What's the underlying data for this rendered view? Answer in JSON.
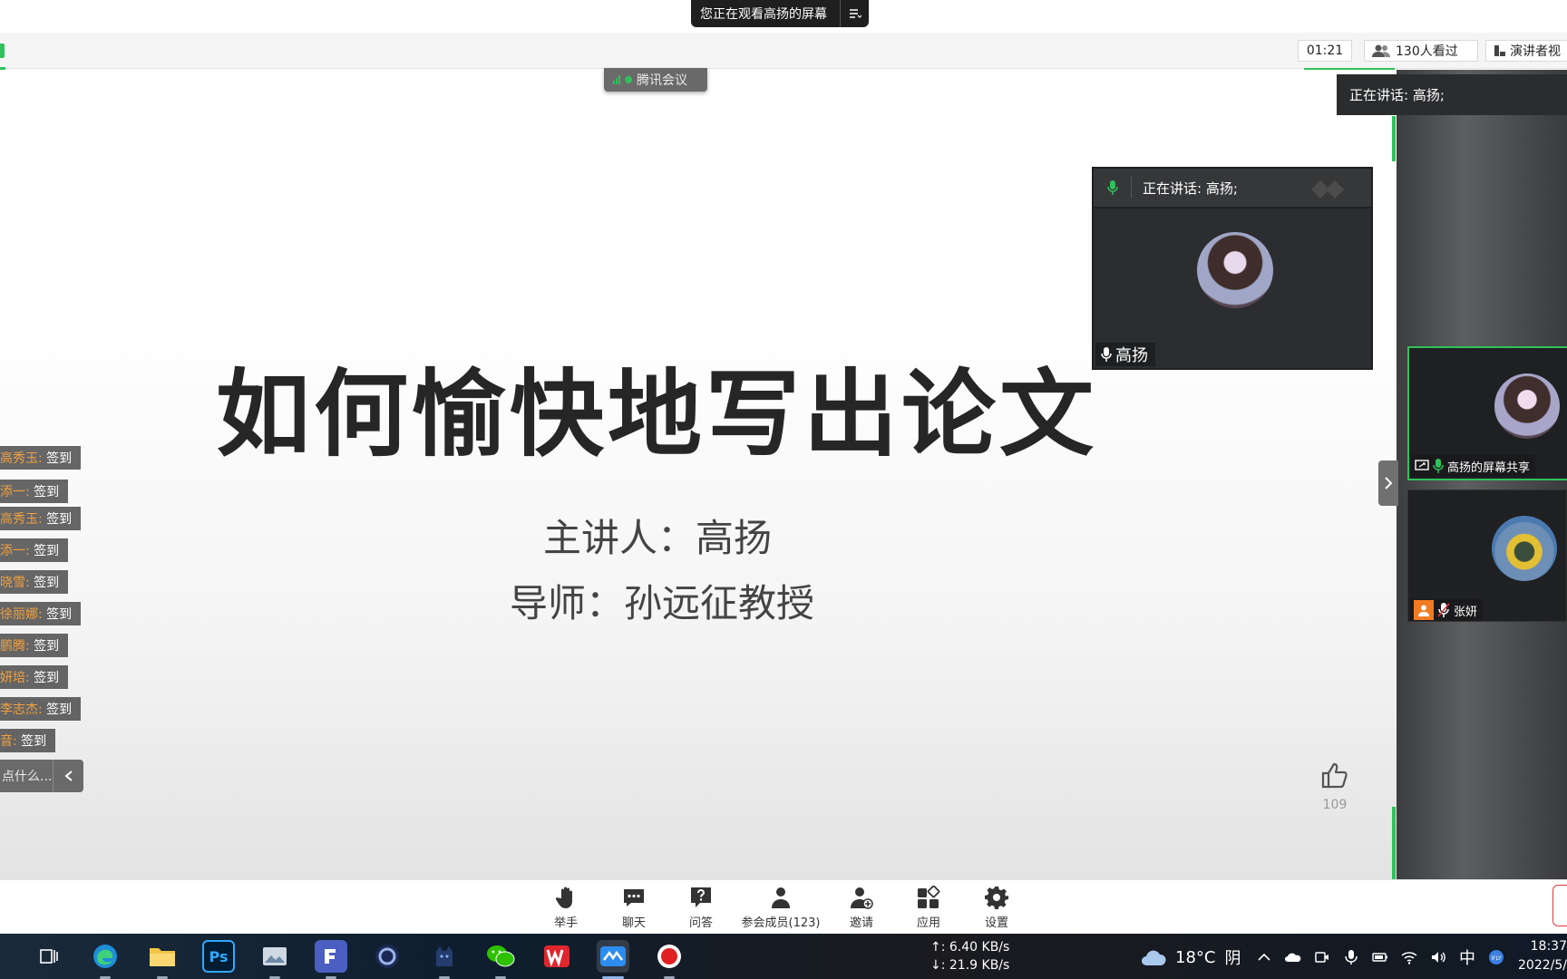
{
  "share_banner": {
    "text": "您正在观看高扬的屏幕"
  },
  "topbar": {
    "timer": "01:21",
    "viewers": "130人看过",
    "speaker_view": "演讲者视"
  },
  "tencent_tag": "腾讯会议",
  "slide": {
    "title": "如何愉快地写出论文",
    "presenter": "主讲人：高扬",
    "mentor": "导师：孙远征教授"
  },
  "likes": "109",
  "chat": {
    "messages": [
      {
        "user": "高秀玉:",
        "text": "签到"
      },
      {
        "user": "添一:",
        "text": "签到"
      },
      {
        "user": "高秀玉:",
        "text": "签到"
      },
      {
        "user": "添一:",
        "text": "签到"
      },
      {
        "user": "晓雪:",
        "text": "签到"
      },
      {
        "user": "徐丽娜:",
        "text": "签到"
      },
      {
        "user": "鹏腾:",
        "text": "签到"
      },
      {
        "user": "妍培:",
        "text": "签到"
      },
      {
        "user": "李志杰:",
        "text": "签到"
      },
      {
        "user": "音:",
        "text": "签到"
      }
    ],
    "input_placeholder": "点什么...",
    "input_placeholder_2": "点什么..."
  },
  "float_window": {
    "speaking": "正在讲话: 高扬;",
    "name": "高扬"
  },
  "right_panel": {
    "speaking": "正在讲话: 高扬;",
    "tiles": [
      {
        "label": "高扬的屏幕共享"
      },
      {
        "label": "张妍"
      }
    ]
  },
  "toolbar": {
    "items": [
      {
        "label": "举手",
        "icon": "raise-hand-icon"
      },
      {
        "label": "聊天",
        "icon": "chat-icon"
      },
      {
        "label": "问答",
        "icon": "question-icon"
      },
      {
        "label": "参会成员(123)",
        "icon": "members-icon"
      },
      {
        "label": "邀请",
        "icon": "invite-icon"
      },
      {
        "label": "应用",
        "icon": "apps-icon"
      },
      {
        "label": "设置",
        "icon": "settings-icon"
      }
    ]
  },
  "taskbar": {
    "upload": "↑: 6.40 KB/s",
    "download": "↓: 21.9 KB/s",
    "temperature": "18°C",
    "weather": "阴",
    "ime": "中",
    "time": "18:37",
    "date": "2022/5/"
  },
  "colors": {
    "accent_green": "#2fc25b",
    "danmaku_user": "#f0a040",
    "record_red": "#e02020"
  }
}
